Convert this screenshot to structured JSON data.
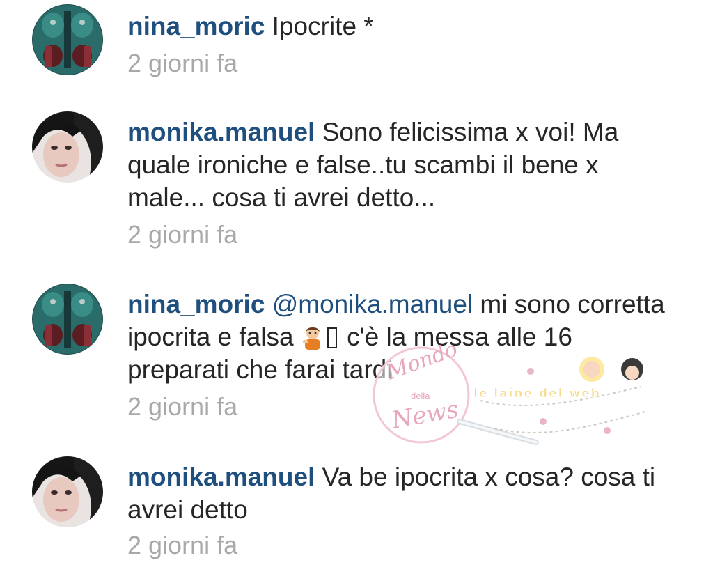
{
  "comments": [
    {
      "username": "nina_moric",
      "text": " Ipocrite *",
      "time": "2 giorni fa",
      "avatar": "nina-avatar"
    },
    {
      "username": "monika.manuel",
      "text": " Sono felicissima x voi! Ma quale ironiche e false..tu scambi il bene x male... cosa ti avrei detto...",
      "time": "2 giorni fa",
      "avatar": "monika-avatar"
    },
    {
      "username": "nina_moric",
      "mention": "@monika.manuel",
      "text_before_emoji": " mi sono corretta ipocrita e falsa ",
      "text_after_emoji": " c'è la messa alle 16 preparati che farai tardi",
      "emoji": "person-tipping-hand-emoji",
      "time": "2 giorni fa",
      "avatar": "nina-avatar"
    },
    {
      "username": "monika.manuel",
      "text": " Va be ipocrita x cosa? cosa ti avrei detto",
      "time": "2 giorni fa",
      "avatar": "monika-avatar"
    }
  ],
  "watermark": {
    "line1": "Mondo",
    "line2": "della",
    "line3": "News",
    "line4": "le laine del web"
  },
  "colors": {
    "username": "#1f4f7e",
    "text": "#262626",
    "timestamp": "#a8a8a8",
    "background": "#ffffff"
  }
}
